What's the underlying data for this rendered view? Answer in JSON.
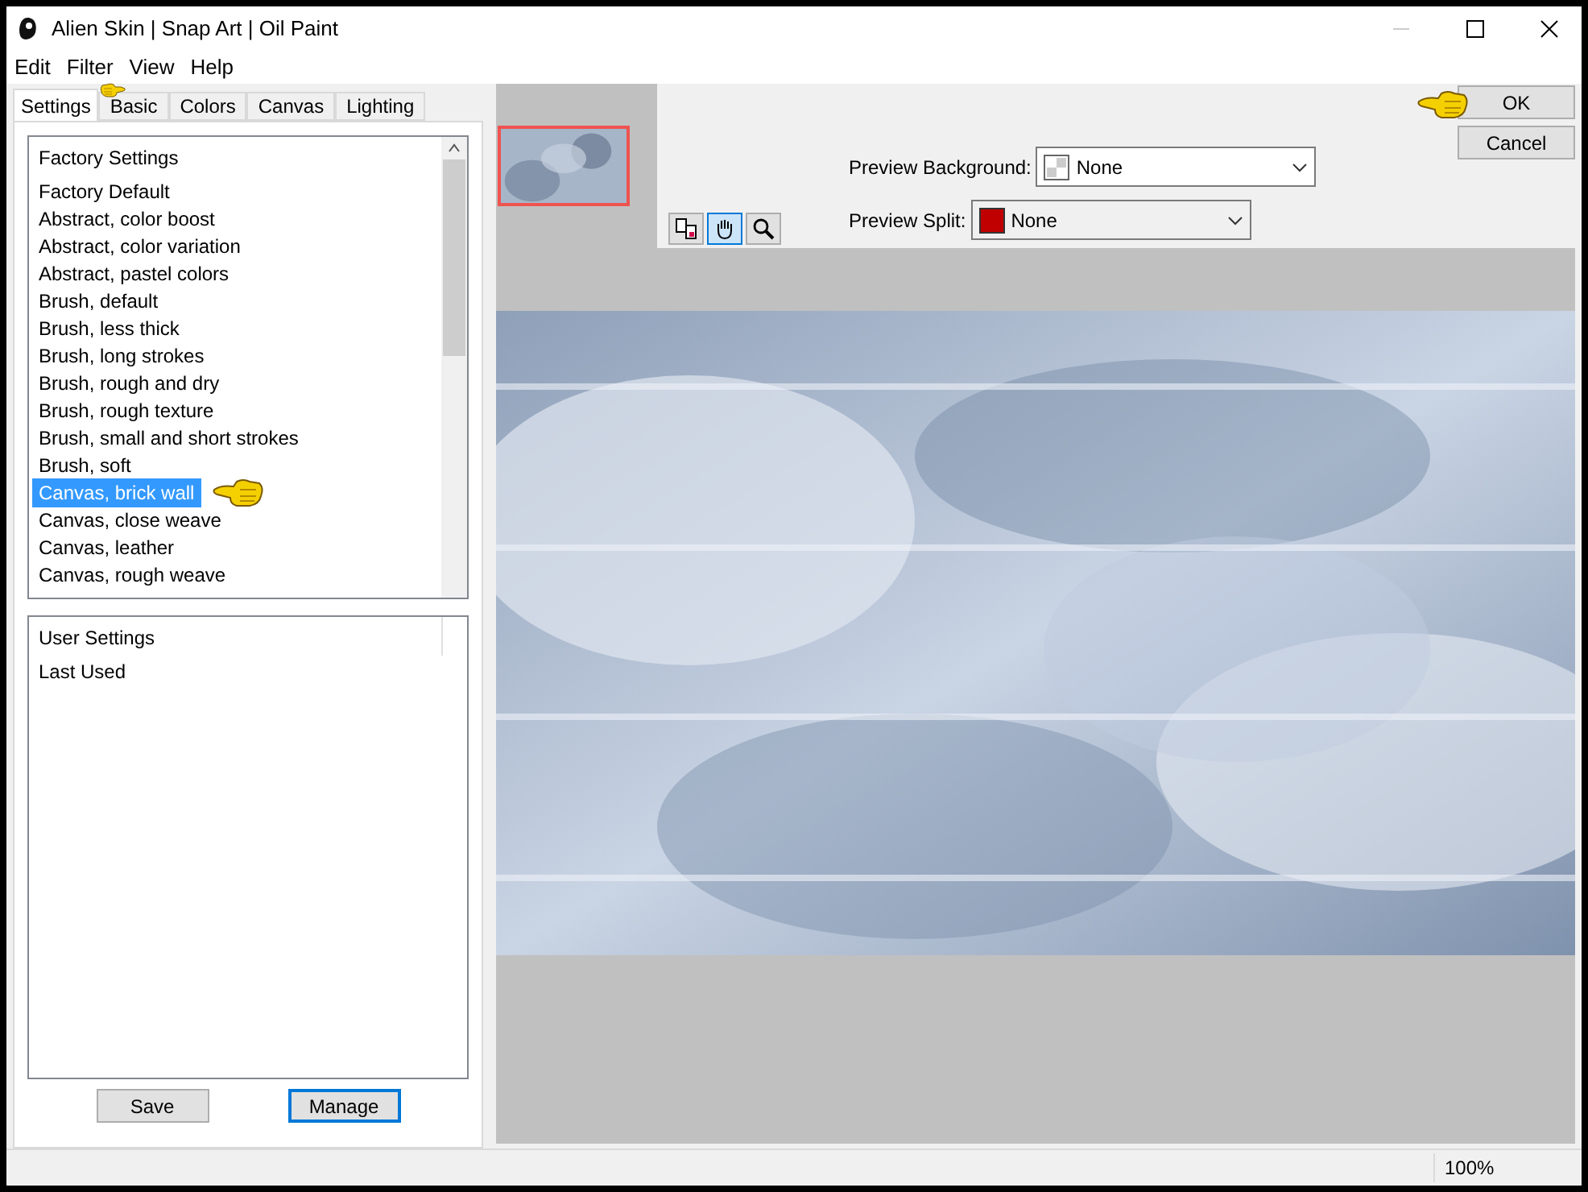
{
  "window": {
    "title": "Alien Skin | Snap Art | Oil Paint"
  },
  "menu": [
    "Edit",
    "Filter",
    "View",
    "Help"
  ],
  "tabs": [
    {
      "label": "Settings",
      "selected": true
    },
    {
      "label": "Basic",
      "selected": false
    },
    {
      "label": "Colors",
      "selected": false
    },
    {
      "label": "Canvas",
      "selected": false
    },
    {
      "label": "Lighting",
      "selected": false
    }
  ],
  "factory_settings": {
    "header": "Factory Settings",
    "items": [
      {
        "label": "Factory Default",
        "selected": false
      },
      {
        "label": "Abstract, color boost",
        "selected": false
      },
      {
        "label": "Abstract, color variation",
        "selected": false
      },
      {
        "label": "Abstract, pastel colors",
        "selected": false
      },
      {
        "label": "Brush, default",
        "selected": false
      },
      {
        "label": "Brush, less thick",
        "selected": false
      },
      {
        "label": "Brush, long strokes",
        "selected": false
      },
      {
        "label": "Brush, rough and dry",
        "selected": false
      },
      {
        "label": "Brush, rough texture",
        "selected": false
      },
      {
        "label": "Brush, small and short strokes",
        "selected": false
      },
      {
        "label": "Brush, soft",
        "selected": false
      },
      {
        "label": "Canvas, brick wall",
        "selected": true
      },
      {
        "label": "Canvas, close weave",
        "selected": false
      },
      {
        "label": "Canvas, leather",
        "selected": false
      },
      {
        "label": "Canvas, rough weave",
        "selected": false
      }
    ]
  },
  "user_settings": {
    "header": "User Settings",
    "items": [
      "Last Used"
    ]
  },
  "left_buttons": [
    {
      "label": "Save",
      "focused": false
    },
    {
      "label": "Manage",
      "focused": true
    }
  ],
  "preview_background": {
    "label": "Preview Background:",
    "value": "None"
  },
  "preview_split": {
    "label": "Preview Split:",
    "value": "None",
    "color": "#c00000"
  },
  "dialog_buttons": [
    "OK",
    "Cancel"
  ],
  "status_bar": {
    "zoom": "100%"
  }
}
